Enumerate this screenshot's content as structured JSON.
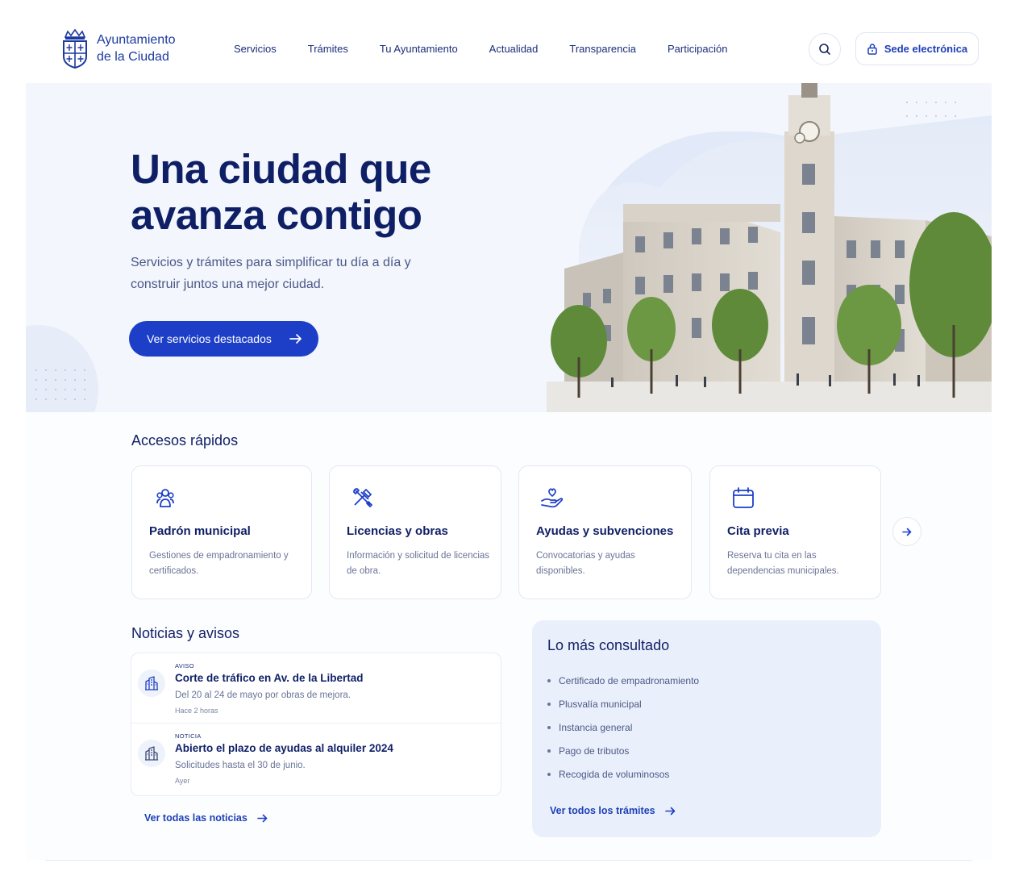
{
  "brand": {
    "line1": "Ayuntamiento",
    "line2": "de la Ciudad"
  },
  "nav": [
    "Servicios",
    "Trámites",
    "Tu Ayuntamiento",
    "Actualidad",
    "Transparencia",
    "Participación"
  ],
  "header": {
    "sede_label": "Sede electrónica"
  },
  "hero": {
    "title": "Una ciudad que avanza contigo",
    "subtitle": "Servicios y trámites para simplificar tu día a día y construir juntos una mejor ciudad.",
    "cta": "Ver servicios destacados"
  },
  "quick_access": {
    "title": "Accesos rápidos",
    "cards": [
      {
        "icon": "people-icon",
        "title": "Padrón municipal",
        "desc": "Gestiones de empadronamiento y certificados."
      },
      {
        "icon": "tools-icon",
        "title": "Licencias y obras",
        "desc": "Información y solicitud de licencias de obra."
      },
      {
        "icon": "hand-heart-icon",
        "title": "Ayudas y subvenciones",
        "desc": "Convocatorias y ayudas disponibles."
      },
      {
        "icon": "calendar-icon",
        "title": "Cita previa",
        "desc": "Reserva tu cita en las dependencias municipales."
      }
    ]
  },
  "news": {
    "title": "Noticias y avisos",
    "items": [
      {
        "tag": "AVISO",
        "title": "Corte de tráfico en Av. de la Libertad",
        "desc": "Del 20 al 24 de mayo por obras de mejora.",
        "time": "Hace 2 horas"
      },
      {
        "tag": "NOTICIA",
        "title": "Abierto el plazo de ayudas al alquiler 2024",
        "desc": "Solicitudes hasta el 30 de junio.",
        "time": "Ayer"
      }
    ],
    "link": "Ver todas las noticias"
  },
  "popular": {
    "title": "Lo más consultado",
    "items": [
      "Certificado de empadronamiento",
      "Plusvalía municipal",
      "Instancia general",
      "Pago de tributos",
      "Recogida de voluminosos"
    ],
    "link": "Ver todos los trámites"
  },
  "colors": {
    "primary": "#1d3fc8",
    "navy": "#0f1f66",
    "muted": "#6a7496",
    "hero_bg": "#f3f6fc",
    "panel": "#eaf0fb"
  }
}
